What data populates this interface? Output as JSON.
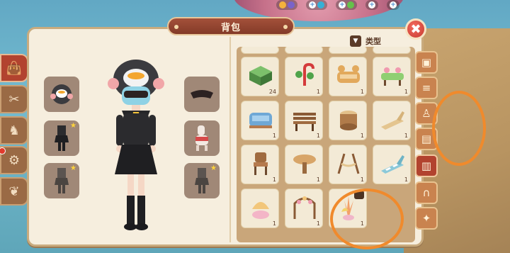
{
  "title": "背包",
  "filter_label": "类型",
  "close_icon": "x-icon",
  "colors": {
    "panel_bg": "#f6eede",
    "accent_red": "#b2432f",
    "banner": "#a4513a",
    "annotation": "#f08a2c"
  },
  "left_tabs": [
    {
      "icon": "bag-icon",
      "active": true
    },
    {
      "icon": "tools-icon",
      "active": false
    },
    {
      "icon": "chair-icon",
      "active": false
    },
    {
      "icon": "gear-icon",
      "active": false
    },
    {
      "icon": "candy-icon",
      "active": false
    }
  ],
  "equip_slots": [
    {
      "icon": "penguin-hat-icon"
    },
    {
      "icon": "mask-icon"
    },
    {
      "icon": "outfit-icon"
    },
    {
      "icon": "alpaca-icon"
    },
    {
      "icon": "outfit-icon"
    },
    {
      "icon": "outfit-icon"
    }
  ],
  "items": [
    {
      "name": "hedge-block",
      "qty": "24"
    },
    {
      "name": "candy-cane-tree",
      "qty": "1"
    },
    {
      "name": "dog-sofa",
      "qty": "1"
    },
    {
      "name": "flower-bench",
      "qty": "1"
    },
    {
      "name": "blue-sofa",
      "qty": "1"
    },
    {
      "name": "wooden-bench",
      "qty": "1"
    },
    {
      "name": "stump-stool",
      "qty": "1"
    },
    {
      "name": "lounge-chair",
      "qty": "1"
    },
    {
      "name": "wooden-chair",
      "qty": "1"
    },
    {
      "name": "round-table",
      "qty": "1"
    },
    {
      "name": "rope-rack",
      "qty": "1"
    },
    {
      "name": "striped-lounge",
      "qty": "1"
    },
    {
      "name": "shell-lamp",
      "qty": "1"
    },
    {
      "name": "floral-arch",
      "qty": "1"
    },
    {
      "name": "coral-plant",
      "qty": "1"
    }
  ],
  "right_tabs": [
    {
      "icon": "box-icon",
      "active": false
    },
    {
      "icon": "burger-icon",
      "active": false
    },
    {
      "icon": "shirt-icon",
      "active": false
    },
    {
      "icon": "sofa-icon",
      "active": false
    },
    {
      "icon": "fence-icon",
      "active": true
    },
    {
      "icon": "horseshoe-icon",
      "active": false
    },
    {
      "icon": "compass-icon",
      "active": false
    }
  ]
}
